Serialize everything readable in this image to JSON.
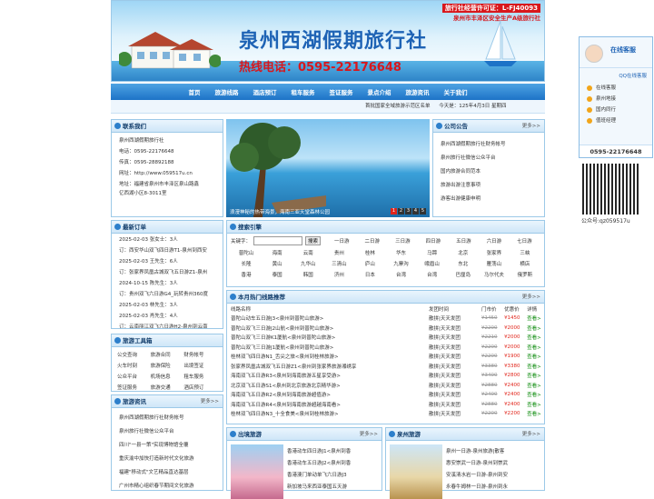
{
  "banner": {
    "brand": "泉州西湖假期旅行社",
    "hotline": "热线电话：0595-22176648",
    "license_no": "旅行社经营许可证：L-FJ40093",
    "license_note": "泉州市丰泽区安全生产A级旅行社"
  },
  "nav": [
    "首页",
    "旅游线路",
    "酒店预订",
    "租车服务",
    "签证服务",
    "景点介绍",
    "旅游资讯",
    "关于我们"
  ],
  "subbar": {
    "notice": "首批国家全域旅游示范区名单",
    "date": "今天是：125年4月3日 星期四"
  },
  "contact": {
    "title": "联系我们",
    "lines": [
      "泉州西湖假期旅行社",
      "电话：0595-22176648",
      "传真：0595-28892188",
      "网址：http://www.059517u.cn",
      "地址：福建省泉州市丰泽区泉山路鑫",
      "亿西湖小区8-3011室"
    ]
  },
  "orders": {
    "title": "最新订单",
    "lines": [
      "2025-02-03 张女士：3人",
      "订：西安华山双飞四日游T1-泉州到西安",
      "2025-02-03 王先生：6人",
      "订：张家界凤凰古城双飞五日游Z1-泉州",
      "2024-10-15 陈先生：3人",
      "订：贵州双飞六日游G4_玩转贵州360度",
      "2025-02-03 林先生：3人",
      "2025-02-03 肖先生：4人",
      "订：云南丽江双飞六日游H2-泉州到云南"
    ]
  },
  "tools": {
    "title": "旅游工具箱",
    "items": [
      "公交查询",
      "旅游合同",
      "财务帐号",
      "火车时刻",
      "旅游保险",
      "出境签证",
      "公众平台",
      "机场信息",
      "租车服务",
      "签证服务",
      "旅游交通",
      "酒店预订"
    ]
  },
  "info": {
    "title": "旅游资讯",
    "more": "更多>>",
    "lines": [
      "泉州西湖假期旅行社财务帐号",
      "泉州旅行社微信公众平台",
      "四川\"一县一策\"实现博物馆全覆",
      "重庆渝中加快打造新时代文化旅游",
      "福建\"移动式\"文艺精品直达基层",
      "广州市精心组织春节期间文化旅游"
    ]
  },
  "slider": {
    "caption": "浪漫神秘的热带海景，海南三亚天堂森林公园",
    "pages": [
      "1",
      "2",
      "3",
      "4",
      "5"
    ]
  },
  "notice": {
    "title": "公司公告",
    "more": "更多>>",
    "lines": [
      "泉州西湖假期旅行社财务帐号",
      "泉州旅行社微信公众平台",
      "国内旅游合同范本",
      "旅游出游注意事项",
      "游客出游健康申明"
    ]
  },
  "search": {
    "title": "搜索引擎",
    "label": "关键字：",
    "button": "搜索",
    "days": [
      "一日游",
      "二日游",
      "三日游",
      "四日游",
      "五日游",
      "六日游",
      "七日游"
    ],
    "keywords": [
      "普陀山",
      "海南",
      "云南",
      "贵州",
      "桂林",
      "华东",
      "马蹄",
      "北京",
      "张家界",
      "三峡",
      "长隆",
      "黄山",
      "九华山",
      "三清山",
      "庐山",
      "九寨沟",
      "峨眉山",
      "东北",
      "雁荡山",
      "横店",
      "香港",
      "泰国",
      "韩国",
      "济州",
      "日本",
      "台湾",
      "台湾",
      "巴厘岛",
      "马尔代夫",
      "俄罗斯"
    ]
  },
  "hot": {
    "title": "本月热门线路推荐",
    "more": "更多>>",
    "headers": [
      "线路名称",
      "发团时间",
      "门市价",
      "优惠价",
      "详情"
    ],
    "rows": [
      [
        "普陀山动车五日游J3<泉州到普陀山旅游>",
        "散拼|天天发团",
        "¥1450",
        "¥1450",
        "查看>"
      ],
      [
        "普陀山双飞三日游J2山航<泉州到普陀山旅游>",
        "散拼|天天发团",
        "¥2200",
        "¥2000",
        "查看>"
      ],
      [
        "普陀山双飞三日游K1厦航<泉州到普陀山旅游>",
        "散拼|天天发团",
        "¥2210",
        "¥2000",
        "查看>"
      ],
      [
        "普陀山双飞三日游J1厦航<泉州到普陀山旅游>",
        "散拼|天天发团",
        "¥2200",
        "¥2000",
        "查看>"
      ],
      [
        "桂林双飞四日游N1_舌尖之旅<泉州到桂林旅游>",
        "散拼|天天发团",
        "¥2200",
        "¥1900",
        "查看>"
      ],
      [
        "张家界凤凰古城双飞五日游Z1<泉州到张家界旅游湘绣享",
        "散拼|天天发团",
        "¥3380",
        "¥3380",
        "查看>"
      ],
      [
        "海南双飞五日游R3<泉州到海南旅游五星享受游>",
        "散拼|天天发团",
        "¥3400",
        "¥2800",
        "查看>"
      ],
      [
        "北京双飞五日游S1<泉州到北京旅游北京精华游>",
        "散拼|天天发团",
        "¥2880",
        "¥2400",
        "查看>"
      ],
      [
        "海南双飞五日游R2<泉州到海南旅游超值游>",
        "散拼|天天发团",
        "¥2400",
        "¥2400",
        "查看>"
      ],
      [
        "海南双飞五日游R4<泉州到海南旅游超越海南看>",
        "散拼|天天发团",
        "¥2880",
        "¥2400",
        "查看>"
      ],
      [
        "桂林双飞四日游N3_十全食美<泉州到桂林旅游>",
        "散拼|天天发团",
        "¥2200",
        "¥2200",
        "查看>"
      ]
    ]
  },
  "outbound": {
    "title": "出境旅游",
    "more": "更多>>",
    "lines": [
      "香港动车四日游J1<泉州到香",
      "香港动车五日游J2<泉州到香",
      "香港澳门单动单飞六日游J3",
      "新加坡马来西亚泰国五天游"
    ]
  },
  "quanzhou": {
    "title": "泉州旅游",
    "more": "更多>>",
    "lines": [
      "泉州一日游-泉州旅游|散客",
      "惠安崇武一日游-泉州到崇武",
      "安溪清水岩一日游-泉州到安",
      "永春牛姆林一日游-泉州到永"
    ]
  },
  "float": {
    "title": "在线客服",
    "qq": "QQ在线客服",
    "items": [
      "在线客服",
      "泉州地接",
      "国内同行",
      "值班经理"
    ],
    "phone": "0595-22176648",
    "wechat": "公众号:qz059517u"
  }
}
